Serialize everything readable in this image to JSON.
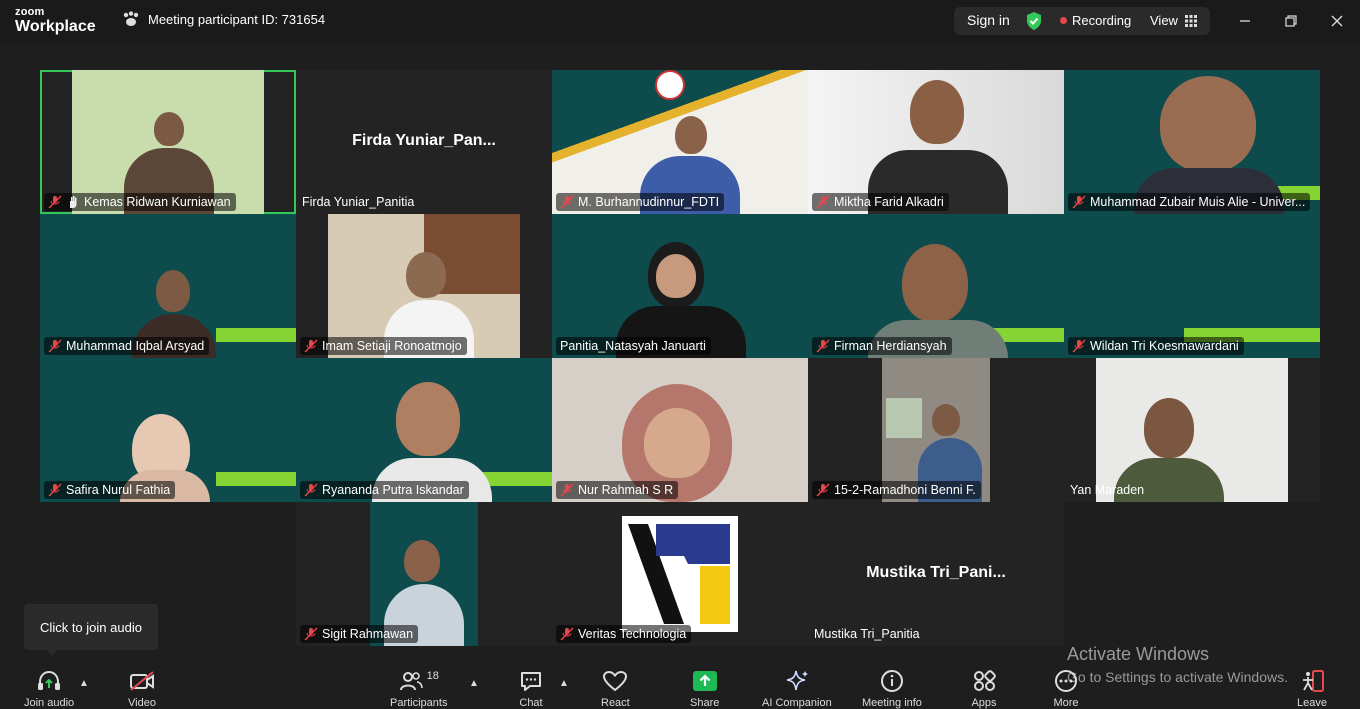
{
  "app": {
    "brand_small": "zoom",
    "brand_big": "Workplace"
  },
  "header": {
    "meeting_id": "Meeting participant ID: 731654",
    "sign_in": "Sign in",
    "recording": "Recording",
    "view": "View"
  },
  "tiles": [
    {
      "name": "Kemas Ridwan Kurniawan",
      "muted": true
    },
    {
      "name": "Firda Yuniar_Panitia",
      "display": "Firda  Yuniar_Pan...",
      "muted": false
    },
    {
      "name": "M. Burhannudinnur_FDTI",
      "muted": true
    },
    {
      "name": "Miktha Farid Alkadri",
      "muted": true
    },
    {
      "name": "Muhammad Zubair Muis Alie - Univer...",
      "muted": true
    },
    {
      "name": "Muhammad Iqbal Arsyad",
      "muted": true
    },
    {
      "name": "Imam Setiaji Ronoatmojo",
      "muted": true
    },
    {
      "name": "Panitia_Natasyah Januarti",
      "muted": false
    },
    {
      "name": "Firman Herdiansyah",
      "muted": true
    },
    {
      "name": "Wildan Tri Koesmawardani",
      "muted": true
    },
    {
      "name": "Safira Nurul Fathia",
      "muted": true
    },
    {
      "name": "Ryananda Putra Iskandar",
      "muted": true
    },
    {
      "name": "Nur Rahmah S R",
      "muted": true
    },
    {
      "name": "15-2-Ramadhoni Benni F.",
      "muted": true
    },
    {
      "name": "Yan Maraden",
      "muted": false
    },
    {
      "name": "Sigit Rahmawan",
      "muted": true
    },
    {
      "name": "Veritas Technologia",
      "muted": true
    },
    {
      "name": "Mustika Tri_Panitia",
      "display": "Mustika  Tri_Pani...",
      "muted": false
    }
  ],
  "tooltip": "Click to join audio",
  "toolbar": {
    "join_audio": "Join audio",
    "video": "Video",
    "participants": "Participants",
    "participants_count": "18",
    "chat": "Chat",
    "react": "React",
    "share": "Share",
    "ai_companion": "AI Companion",
    "meeting_info": "Meeting info",
    "apps": "Apps",
    "more": "More",
    "leave": "Leave"
  },
  "watermark": {
    "line1": "Activate Windows",
    "line2": "Go to Settings to activate Windows."
  },
  "colors": {
    "accent_green": "#34c759",
    "share_green": "#1db954",
    "recording_red": "#e5484d",
    "teal_bg": "#0d4b4d"
  }
}
